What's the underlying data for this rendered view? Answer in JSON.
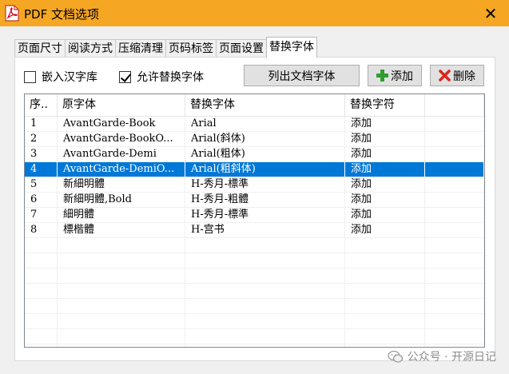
{
  "window": {
    "title": "PDF 文档选项",
    "close_glyph": "✕",
    "icon": "pdf-app-icon",
    "titlebar_color": "#f5a623"
  },
  "tabs": [
    {
      "label": "页面尺寸",
      "active": false
    },
    {
      "label": "阅读方式",
      "active": false
    },
    {
      "label": "压缩清理",
      "active": false
    },
    {
      "label": "页码标签",
      "active": false
    },
    {
      "label": "页面设置",
      "active": false
    },
    {
      "label": "替换字体",
      "active": true
    }
  ],
  "options": {
    "embed_chinese": {
      "label": "嵌入汉字库",
      "checked": false
    },
    "allow_replace": {
      "label": "允许替换字体",
      "checked": true
    }
  },
  "buttons": {
    "list_fonts": "列出文档字体",
    "add": {
      "label": "添加",
      "icon": "plus-icon",
      "color": "#2e9e2e"
    },
    "delete": {
      "label": "删除",
      "icon": "delete-x-icon",
      "color": "#d9261c"
    }
  },
  "table": {
    "columns": [
      "序..",
      "原字体",
      "替换字体",
      "替换字符"
    ],
    "rows": [
      {
        "no": "1",
        "orig": "AvantGarde-Book",
        "repl": "Arial",
        "chars": "添加",
        "selected": false
      },
      {
        "no": "2",
        "orig": "AvantGarde-BookO...",
        "repl": "Arial(斜体)",
        "chars": "添加",
        "selected": false
      },
      {
        "no": "3",
        "orig": "AvantGarde-Demi",
        "repl": "Arial(粗体)",
        "chars": "添加",
        "selected": false
      },
      {
        "no": "4",
        "orig": "AvantGarde-DemiO...",
        "repl": "Arial(粗斜体)",
        "chars": "添加",
        "selected": true
      },
      {
        "no": "5",
        "orig": "新細明體",
        "repl": "H-秀月-標準",
        "chars": "添加",
        "selected": false
      },
      {
        "no": "6",
        "orig": "新細明體,Bold",
        "repl": "H-秀月-粗體",
        "chars": "添加",
        "selected": false
      },
      {
        "no": "7",
        "orig": "細明體",
        "repl": "H-秀月-標準",
        "chars": "添加",
        "selected": false
      },
      {
        "no": "8",
        "orig": "標楷體",
        "repl": "H-宫书",
        "chars": "添加",
        "selected": false
      }
    ],
    "selection_color": "#0078d7"
  },
  "watermark": {
    "text": "公众号 · 开源日记",
    "icon": "wechat-icon"
  }
}
